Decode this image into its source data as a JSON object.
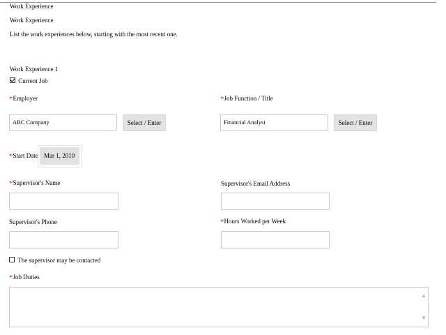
{
  "header": {
    "top_title": "Work Experience",
    "section_title": "Work Experience",
    "instructions": "List the work experiences below, starting with the most recent one."
  },
  "entry": {
    "heading": "Work Experience 1",
    "current_job": {
      "label": "Current Job",
      "checked": true
    },
    "employer": {
      "label": "Employer",
      "required": true,
      "value": "ABC Company",
      "button_label": "Select / Enter"
    },
    "job_function": {
      "label": "Job Function / Title",
      "required": true,
      "value": "Financial Analyst",
      "button_label": "Select / Enter"
    },
    "start_date": {
      "label": "Start Date",
      "required": true,
      "value": "Mar 1, 2010"
    },
    "supervisor_name": {
      "label": "Supervisor's Name",
      "required": true,
      "value": ""
    },
    "supervisor_email": {
      "label": "Supervisor's Email Address",
      "required": false,
      "value": ""
    },
    "supervisor_phone": {
      "label": "Supervisor's Phone",
      "required": false,
      "value": ""
    },
    "hours_per_week": {
      "label": "Hours Worked per Week",
      "required": true,
      "value": ""
    },
    "may_contact": {
      "label": "The supervisor may be contacted",
      "checked": false
    },
    "job_duties": {
      "label": "Job Duties",
      "required": true,
      "value": ""
    }
  },
  "required_marker": "*",
  "colors": {
    "required": "#e01c1c",
    "button_bg": "#e3e3e3",
    "input_border": "#c9c9c9"
  }
}
